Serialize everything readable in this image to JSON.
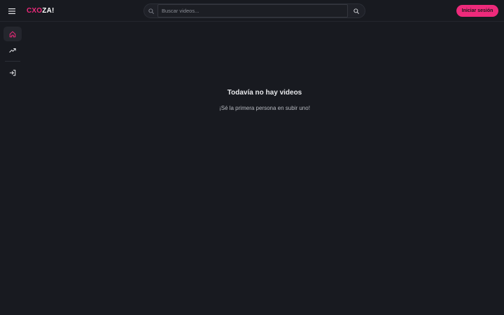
{
  "header": {
    "logo_part1": "CXO",
    "logo_part2": "ZA!",
    "search": {
      "placeholder": "Buscar videos..."
    },
    "login_label": "Iniciar sesión"
  },
  "sidebar": {
    "items": [
      {
        "name": "home",
        "icon": "home-icon",
        "active": true
      },
      {
        "name": "trending",
        "icon": "trending-up-icon",
        "active": false
      },
      {
        "name": "login",
        "icon": "login-icon",
        "active": false
      }
    ]
  },
  "main": {
    "empty_title": "Todavía no hay videos",
    "empty_subtitle": "¡Sé la primera persona en subir uno!"
  },
  "colors": {
    "accent": "#ee2a7b",
    "background": "#181a20",
    "surface": "#24262d"
  }
}
